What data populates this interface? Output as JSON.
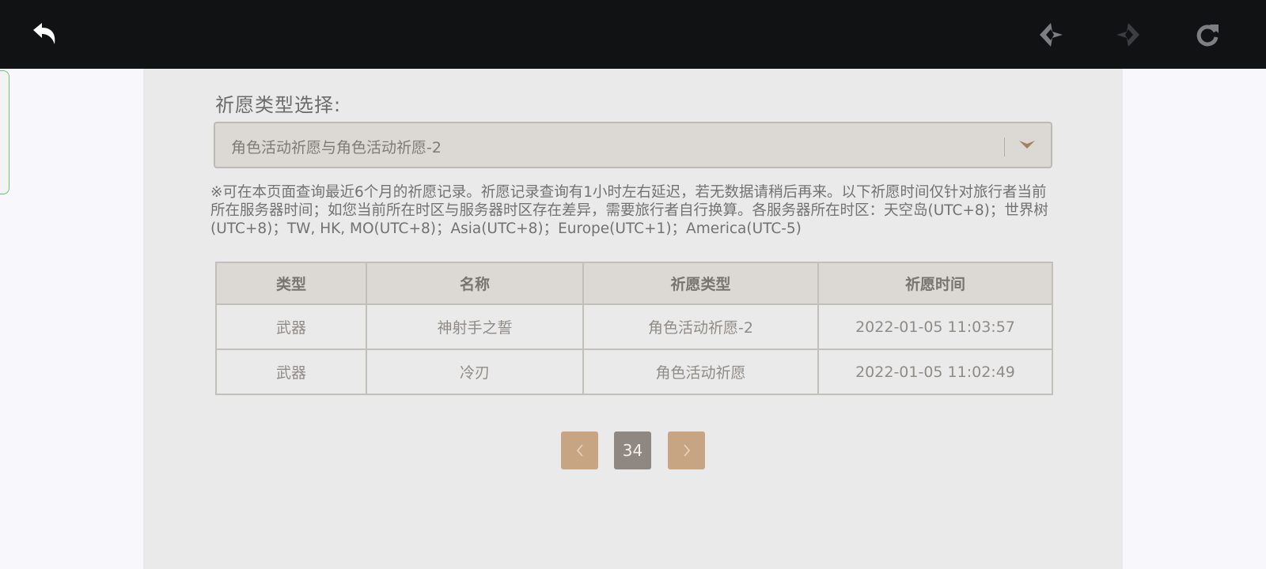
{
  "toolbar": {
    "back_icon": "back-arrow-icon",
    "prev_icon": "prev-diamond-icon",
    "next_icon": "next-diamond-icon",
    "refresh_icon": "refresh-icon",
    "bar_color": "#111214"
  },
  "wish_select": {
    "label": "祈愿类型选择:",
    "selected": "角色活动祈愿与角色活动祈愿-2",
    "caret_icon": "chevron-down-icon",
    "caret_color": "#a0825f"
  },
  "notice": "※可在本页面查询最近6个月的祈愿记录。祈愿记录查询有1小时左右延迟，若无数据请稍后再来。以下祈愿时间仅针对旅行者当前所在服务器时间；如您当前所在时区与服务器时区存在差异，需要旅行者自行换算。各服务器所在时区：天空岛(UTC+8)；世界树(UTC+8)；TW, HK, MO(UTC+8)；Asia(UTC+8)；Europe(UTC+1)；America(UTC-5)",
  "table": {
    "headers": [
      "类型",
      "名称",
      "祈愿类型",
      "祈愿时间"
    ],
    "rows": [
      [
        "武器",
        "神射手之誓",
        "角色活动祈愿-2",
        "2022-01-05 11:03:57"
      ],
      [
        "武器",
        "冷刃",
        "角色活动祈愿",
        "2022-01-05 11:02:49"
      ]
    ]
  },
  "pagination": {
    "current_page": "34",
    "prev_icon": "chevron-left-icon",
    "next_icon": "chevron-right-icon",
    "accent_color": "#c7a582"
  }
}
